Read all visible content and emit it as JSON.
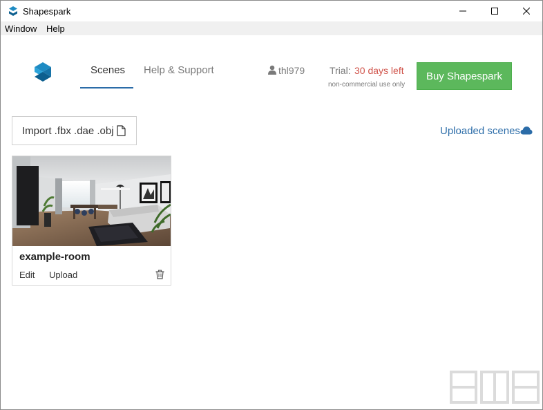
{
  "window": {
    "title": "Shapespark"
  },
  "menu": {
    "items": [
      "Window",
      "Help"
    ]
  },
  "nav": {
    "scenes_label": "Scenes",
    "help_label": "Help & Support"
  },
  "user": {
    "name": "thl979"
  },
  "trial": {
    "label": "Trial:",
    "days_left": "30 days left",
    "note": "non-commercial use only"
  },
  "buy_button": {
    "label": "Buy Shapespark"
  },
  "import_button": {
    "label": "Import .fbx .dae .obj"
  },
  "uploaded_link": {
    "label": "Uploaded scenes"
  },
  "scene": {
    "name": "example-room",
    "edit_label": "Edit",
    "upload_label": "Upload"
  },
  "colors": {
    "accent": "#2b6ca8",
    "buy_green": "#5cb85c",
    "trial_red": "#d0534a",
    "logo_blue": "#1e8bc3"
  },
  "icons": [
    "shapespark-logo-icon",
    "minimize-icon",
    "maximize-icon",
    "close-icon",
    "user-icon",
    "file-icon",
    "cloud-icon",
    "trash-icon"
  ]
}
